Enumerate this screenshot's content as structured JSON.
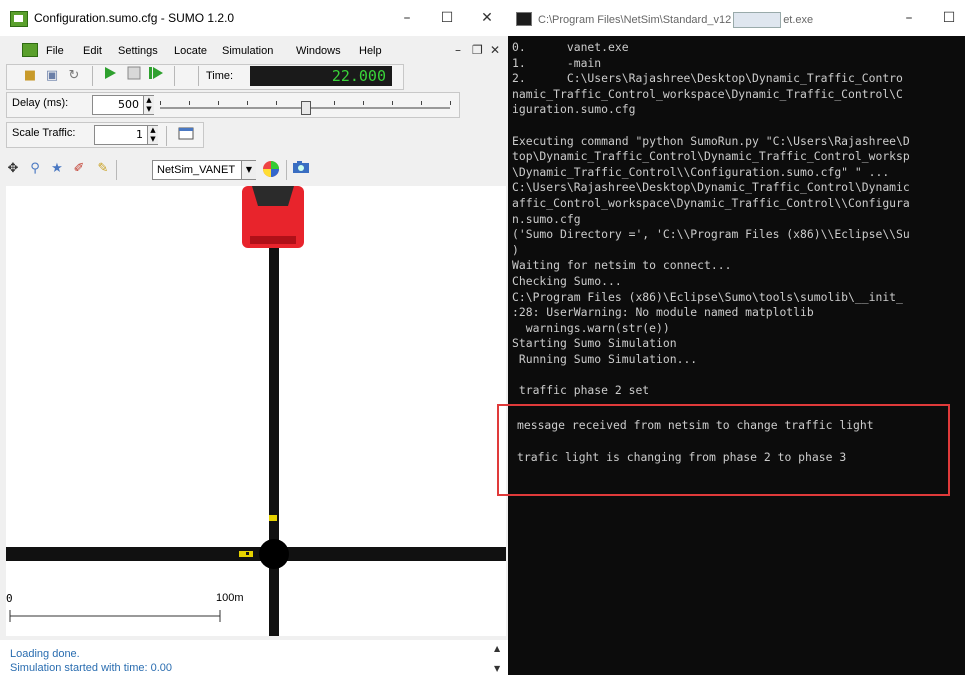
{
  "sumo": {
    "title": "Configuration.sumo.cfg - SUMO 1.2.0",
    "window_controls": {
      "minimize": "–",
      "maximize": "☐",
      "close": "✕"
    },
    "mdi_controls": {
      "minimize": "–",
      "restore": "❐",
      "close": "✕"
    },
    "menu": [
      "File",
      "Edit",
      "Settings",
      "Locate",
      "Simulation",
      "Windows",
      "Help"
    ],
    "toolbar": {
      "time_label": "Time:",
      "time_value": "22.000",
      "delay_label": "Delay (ms):",
      "delay_value": "500",
      "scale_label": "Scale Traffic:",
      "scale_value": "1",
      "delay_slider_fraction": 0.5
    },
    "view": {
      "scheme_value": "NetSim_VANET"
    },
    "scale_bar": {
      "start": "0",
      "end": "100m"
    },
    "status": [
      "Loading done.",
      "Simulation started with time: 0.00"
    ]
  },
  "console": {
    "title": "C:\\Program Files\\NetSim\\Standard_v12",
    "title_tail": "et.exe",
    "window_controls": {
      "minimize": "–",
      "maximize": "☐"
    },
    "lines": [
      "0.      vanet.exe",
      "1.      -main",
      "2.      C:\\Users\\Rajashree\\Desktop\\Dynamic_Traffic_Contro",
      "namic_Traffic_Control_workspace\\Dynamic_Traffic_Control\\C",
      "iguration.sumo.cfg",
      "",
      "Executing command \"python SumoRun.py \"C:\\Users\\Rajashree\\D",
      "top\\Dynamic_Traffic_Control\\Dynamic_Traffic_Control_worksp",
      "\\Dynamic_Traffic_Control\\\\Configuration.sumo.cfg\" \" ...",
      "C:\\Users\\Rajashree\\Desktop\\Dynamic_Traffic_Control\\Dynamic",
      "affic_Control_workspace\\Dynamic_Traffic_Control\\\\Configura",
      "n.sumo.cfg",
      "('Sumo Directory =', 'C:\\\\Program Files (x86)\\\\Eclipse\\\\Su",
      ")",
      "Waiting for netsim to connect...",
      "Checking Sumo...",
      "C:\\Program Files (x86)\\Eclipse\\Sumo\\tools\\sumolib\\__init_",
      ":28: UserWarning: No module named matplotlib",
      "  warnings.warn(str(e))",
      "Starting Sumo Simulation",
      " Running Sumo Simulation...",
      "",
      " traffic phase 2 set"
    ],
    "highlight": [
      "message received from netsim to change traffic light",
      "trafic light is changing from phase 2 to phase 3"
    ]
  },
  "colors": {
    "console_bg": "#0c0c0c",
    "console_text": "#cccccc",
    "highlight_border": "#e03a3a",
    "time_display": "#39d339",
    "vehicle": "#e8242c"
  }
}
